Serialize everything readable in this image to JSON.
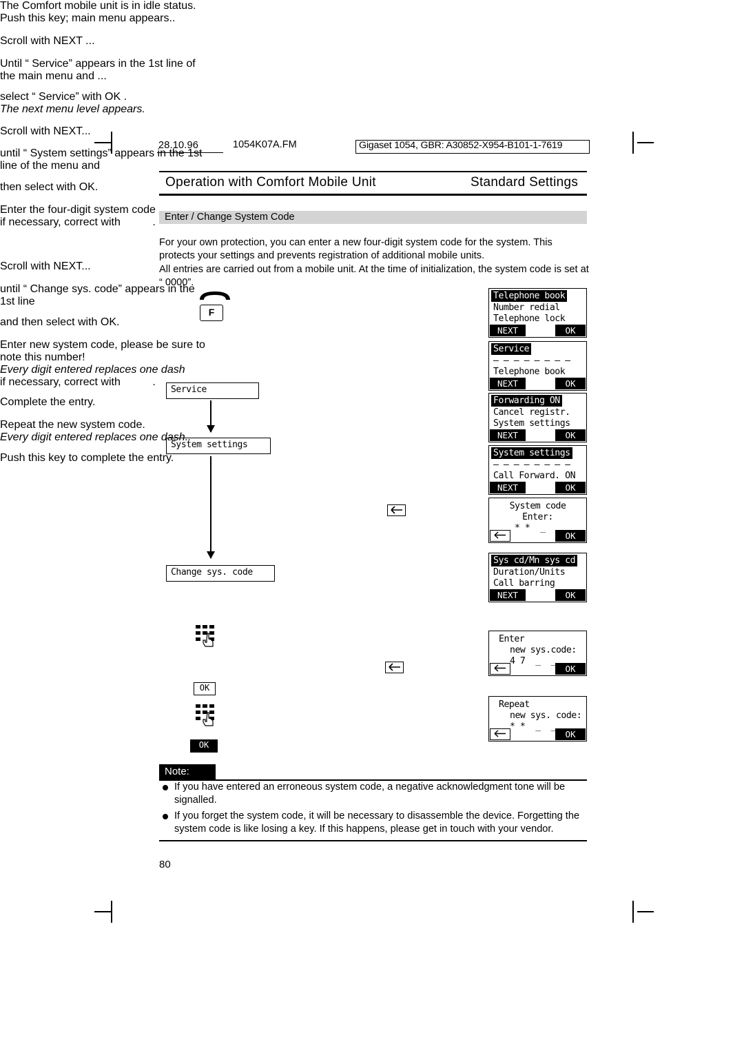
{
  "header": {
    "date": "28.10.96",
    "file": "1054K07A.FM",
    "document_code": "Gigaset 1054, GBR: A30852-X954-B101-1-7619"
  },
  "title": {
    "left": "Operation with Comfort Mobile Unit",
    "right": "Standard Settings"
  },
  "section": {
    "heading": "Enter / Change System Code",
    "intro": "For your own protection, you can enter a new four-digit system code for the system. This protects your settings and prevents registration of additional mobile units.\nAll entries are carried out from a mobile unit. At the time of initialization, the system code is set at “ 0000”."
  },
  "steps": [
    {
      "text": "The Comfort mobile unit is in idle status."
    },
    {
      "text": "Push this key; main menu appears.."
    },
    {
      "text": "Scroll with NEXT ..."
    },
    {
      "text": "Until “ Service” appears in the 1st line of the main menu and ..."
    },
    {
      "text": "select “ Service” with OK ."
    },
    {
      "text": "The next menu level appears.",
      "italic": true
    },
    {
      "text": "Scroll with NEXT..."
    },
    {
      "text": "until “ System settings” appears in the 1st line of the menu and"
    },
    {
      "text": "then select with OK."
    },
    {
      "text": "Enter the four-digit system code"
    },
    {
      "text": "if necessary, correct with"
    },
    {
      "text": "Scroll with NEXT..."
    },
    {
      "text": "until “ Change sys. code” appears in the 1st line"
    },
    {
      "text": "and then select with OK."
    },
    {
      "text": "Enter new system code, please be sure to note this number!"
    },
    {
      "text": "Every digit entered replaces one dash",
      "italic": true
    },
    {
      "text": "if necessary, correct with"
    },
    {
      "text": "Complete the entry."
    },
    {
      "text": "Repeat the new system code."
    },
    {
      "text": "Every digit entered replaces one dash..",
      "italic": true
    },
    {
      "text": "Push this key to complete the entry."
    }
  ],
  "flow": {
    "key_f": "F",
    "box1": "Service",
    "box2": "System settings",
    "box3": "Change sys. code",
    "ok_label": "OK"
  },
  "displays": [
    {
      "name": "telephone-book",
      "lines": [
        {
          "text": "Telephone book",
          "style": "inverse"
        },
        {
          "text": "Number redial",
          "style": "normal"
        },
        {
          "text": "Telephone lock",
          "style": "normal"
        }
      ],
      "soft_left": "NEXT",
      "soft_right": "OK"
    },
    {
      "name": "service",
      "lines": [
        {
          "text": "Service",
          "style": "inverse"
        },
        {
          "text": "– – – – – – – –",
          "style": "normal"
        },
        {
          "text": "Telephone book",
          "style": "normal"
        }
      ],
      "soft_left": "NEXT",
      "soft_right": "OK"
    },
    {
      "name": "forwarding-on",
      "lines": [
        {
          "text": "Forwarding ON",
          "style": "inverse"
        },
        {
          "text": "Cancel registr.",
          "style": "normal"
        },
        {
          "text": "System settings",
          "style": "normal"
        }
      ],
      "soft_left": "NEXT",
      "soft_right": "OK"
    },
    {
      "name": "system-settings",
      "lines": [
        {
          "text": "System settings",
          "style": "inverse"
        },
        {
          "text": "– – – – – – – –",
          "style": "normal"
        },
        {
          "text": "Call Forward. ON",
          "style": "normal"
        }
      ],
      "soft_left": "NEXT",
      "soft_right": "OK"
    },
    {
      "name": "system-code-enter",
      "lines": [
        {
          "text": "System code",
          "style": "center"
        },
        {
          "text": "Enter:",
          "style": "center"
        },
        {
          "text": "* *  _  _",
          "style": "center"
        }
      ],
      "soft_left": "back",
      "soft_right": "OK"
    },
    {
      "name": "sys-cd-mn-sys-cd",
      "lines": [
        {
          "text": "Sys cd/Mn sys cd",
          "style": "inverse"
        },
        {
          "text": "Duration/Units",
          "style": "normal"
        },
        {
          "text": "Call barring",
          "style": "normal"
        }
      ],
      "soft_left": "NEXT",
      "soft_right": "OK"
    },
    {
      "name": "enter-new-sys-code",
      "lines": [
        {
          "text": "Enter",
          "style": "left-indent"
        },
        {
          "text": "new sys.code:",
          "style": "indent"
        },
        {
          "text": "4 7  _  _",
          "style": "indent"
        }
      ],
      "soft_left": "back",
      "soft_right": "OK"
    },
    {
      "name": "repeat-new-sys-code",
      "lines": [
        {
          "text": "Repeat",
          "style": "left-indent"
        },
        {
          "text": "new sys. code:",
          "style": "indent"
        },
        {
          "text": "* *  _  _",
          "style": "indent"
        }
      ],
      "soft_left": "back",
      "soft_right": "OK"
    }
  ],
  "note": {
    "label": "Note:",
    "items": [
      "If you have entered an erroneous system code, a negative acknowledgment tone will be signalled.",
      "If you forget the system code, it will be necessary to disassemble the device. Forgetting the system code is like losing a key. If this happens, please get in touch with your vendor."
    ]
  },
  "footer": {
    "page_number": "80"
  }
}
